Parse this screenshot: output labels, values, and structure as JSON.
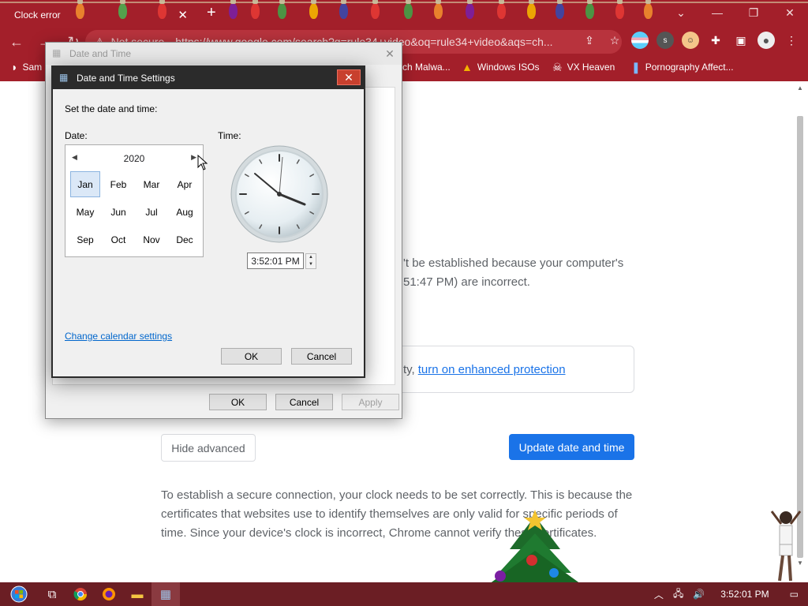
{
  "browser": {
    "tab_title": "Clock error",
    "tab_close": "✕",
    "new_tab": "+",
    "omnibox": {
      "security": "Not secure",
      "url": "https://www.google.com/search?q=rule34+video&oq=rule34+video&aqs=ch..."
    },
    "toolbar_icons": [
      "share-icon",
      "star-icon",
      "extension-flag-icon",
      "s-extension-icon",
      "profile-extension-icon",
      "puzzle-icon",
      "sidebar-icon",
      "avatar-icon",
      "menu-icon"
    ],
    "bookmarks": [
      {
        "label": "Sam"
      },
      {
        "label": "ch Malwa..."
      },
      {
        "label": "Windows ISOs"
      },
      {
        "label": "VX Heaven"
      },
      {
        "label": "Pornography Affect..."
      }
    ],
    "window_controls": [
      "⌄",
      "—",
      "❐",
      "✕"
    ]
  },
  "page": {
    "error_text_line1": "'t be established because your computer's",
    "error_text_line2": "51:47 PM) are incorrect.",
    "partial_button": "...",
    "enhanced_prefix": "ty,",
    "enhanced_link": "turn on enhanced protection",
    "hide_advanced": "Hide advanced",
    "update_button": "Update date and time",
    "explanation": "To establish a secure connection, your clock needs to be set correctly. This is because the certificates that websites use to identify themselves are only valid for specific periods of time. Since your device's clock is incorrect, Chrome cannot verify these certificates."
  },
  "outer_dialog": {
    "title": "Date and Time",
    "ok": "OK",
    "cancel": "Cancel",
    "apply": "Apply"
  },
  "inner_dialog": {
    "title": "Date and Time Settings",
    "instruction": "Set the date and time:",
    "date_label": "Date:",
    "time_label": "Time:",
    "calendar": {
      "year": "2020",
      "months": [
        "Jan",
        "Feb",
        "Mar",
        "Apr",
        "May",
        "Jun",
        "Jul",
        "Aug",
        "Sep",
        "Oct",
        "Nov",
        "Dec"
      ],
      "selected": "Jan"
    },
    "time_value": "3:52:01 PM",
    "change_calendar_link": "Change calendar settings",
    "ok": "OK",
    "cancel": "Cancel"
  },
  "taskbar": {
    "items": [
      "start-button",
      "task-view-icon",
      "chrome-icon",
      "firefox-icon",
      "file-explorer-icon",
      "date-time-settings-icon"
    ],
    "clock": "3:52:01 PM",
    "tray_icons": [
      "chevron-up-icon",
      "network-icon",
      "volume-icon",
      "notification-icon"
    ]
  },
  "colors": {
    "theme": "#a31f2a",
    "link": "#1a73e8",
    "primary_button": "#1a73e8"
  }
}
